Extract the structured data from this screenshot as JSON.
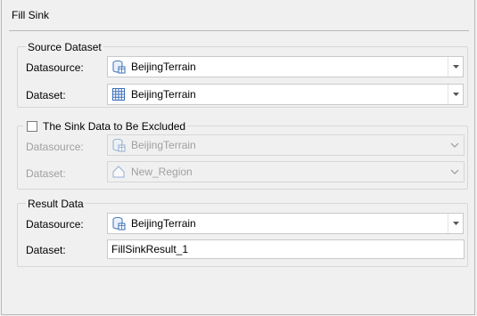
{
  "window": {
    "title": "Fill Sink"
  },
  "source_dataset": {
    "legend": "Source Dataset",
    "datasource_label": "Datasource:",
    "datasource_value": "BeijingTerrain",
    "dataset_label": "Dataset:",
    "dataset_value": "BeijingTerrain"
  },
  "excluded": {
    "legend": "The Sink Data to Be Excluded",
    "checked": false,
    "datasource_label": "Datasource:",
    "datasource_value": "BeijingTerrain",
    "dataset_label": "Dataset:",
    "dataset_value": "New_Region"
  },
  "result_data": {
    "legend": "Result Data",
    "datasource_label": "Datasource:",
    "datasource_value": "BeijingTerrain",
    "dataset_label": "Dataset:",
    "dataset_value": "FillSinkResult_1"
  },
  "icons": {
    "datasource": "database-icon",
    "grid_dataset": "grid-dataset-icon",
    "region_dataset": "region-dataset-icon",
    "dropdown": "chevron-down-icon"
  },
  "colors": {
    "icon_blue": "#3a6fb7",
    "disabled_text": "#a0a0a0"
  }
}
